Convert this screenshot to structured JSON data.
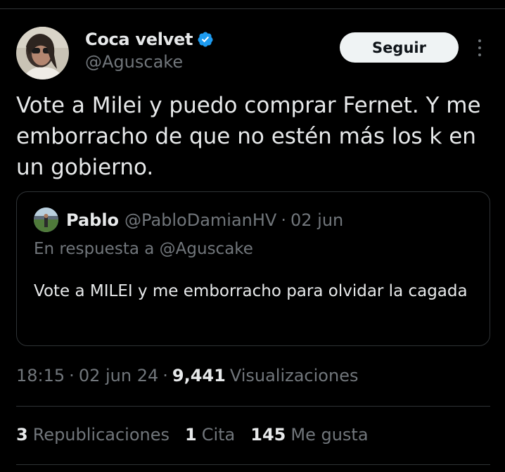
{
  "author": {
    "display_name": "Coca velvet",
    "handle": "@Aguscake",
    "avatar_icon": "user-avatar-photo",
    "verified_icon": "verified-badge-icon",
    "verified_color": "#1d9bf0"
  },
  "follow_button": {
    "label": "Seguir"
  },
  "more_icon": "more-options-icon",
  "tweet": {
    "text": "Vote a Milei y puedo comprar Fernet. Y me emborracho de que no estén más los k en un gobierno."
  },
  "quoted": {
    "author_name": "Pablo",
    "handle": "@PabloDamianHV",
    "separator": "·",
    "date": "02 jun",
    "reply_prefix": "En respuesta a",
    "reply_to": "@Aguscake",
    "text": "Vote a MILEI y me emborracho para olvidar la cagada"
  },
  "meta": {
    "time": "18:15",
    "separator": "·",
    "date": "02 jun 24",
    "views_count": "9,441",
    "views_label": "Visualizaciones"
  },
  "stats": {
    "reposts_count": "3",
    "reposts_label": "Republicaciones",
    "quotes_count": "1",
    "quotes_label": "Cita",
    "likes_count": "145",
    "likes_label": "Me gusta"
  },
  "colors": {
    "background": "#000000",
    "primary_text": "#e7e9ea",
    "secondary_text": "#71767b",
    "border": "#2f3336",
    "follow_bg": "#eff3f4"
  }
}
